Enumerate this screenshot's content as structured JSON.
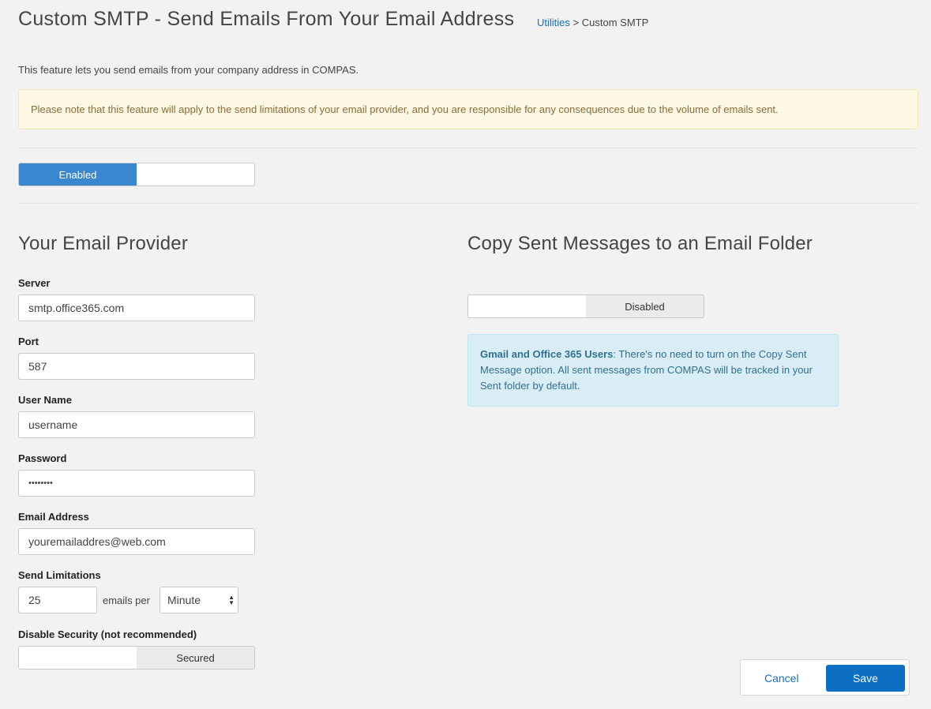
{
  "header": {
    "title": "Custom SMTP - Send Emails From Your Email Address",
    "breadcrumb_link": "Utilities",
    "breadcrumb_sep": ">",
    "breadcrumb_current": "Custom SMTP"
  },
  "intro": "This feature lets you send emails from your company address in COMPAS.",
  "warning": "Please note that this feature will apply to the send limitations of your email provider, and you are responsible for any consequences due to the volume of emails sent.",
  "smtp_toggle": {
    "label": "Enabled",
    "state": "on"
  },
  "provider": {
    "heading": "Your Email Provider",
    "server_label": "Server",
    "server_value": "smtp.office365.com",
    "port_label": "Port",
    "port_value": "587",
    "username_label": "User Name",
    "username_value": "username",
    "password_label": "Password",
    "password_value": "••••••••",
    "email_label": "Email Address",
    "email_value": "youremailaddres@web.com",
    "limit_label": "Send Limitations",
    "limit_value": "25",
    "limit_per": "emails per",
    "limit_unit": "Minute",
    "security_label": "Disable Security (not recommended)",
    "security_toggle": "Secured"
  },
  "copy_sent": {
    "heading": "Copy Sent Messages to an Email Folder",
    "toggle_label": "Disabled",
    "info_bold": "Gmail and Office 365 Users",
    "info_text": ": There's no need to turn on the Copy Sent Message option. All sent messages from COMPAS will be tracked in your Sent folder by default."
  },
  "actions": {
    "cancel": "Cancel",
    "save": "Save"
  },
  "colors": {
    "primary": "#0d6fc4",
    "toggle_on": "#3a86cf",
    "warning_bg": "#fcf8e3",
    "info_bg": "#d9edf7"
  }
}
